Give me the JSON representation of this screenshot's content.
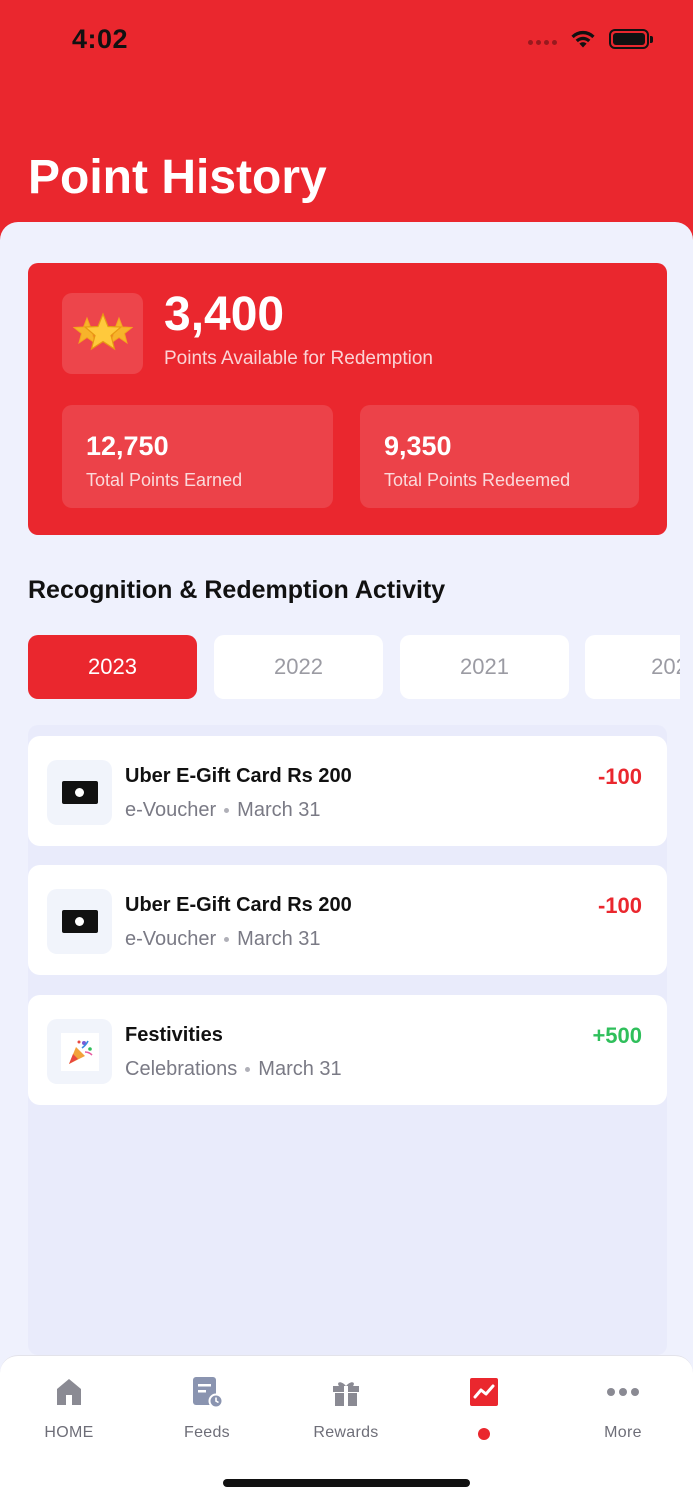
{
  "status_bar": {
    "time": "4:02"
  },
  "header": {
    "title": "Point History"
  },
  "summary": {
    "icon": "star-icon",
    "available_value": "3,400",
    "available_label": "Points Available for Redemption",
    "earned_value": "12,750",
    "earned_label": "Total Points Earned",
    "redeemed_value": "9,350",
    "redeemed_label": "Total Points Redeemed"
  },
  "activity": {
    "section_title": "Recognition & Redemption Activity",
    "years": [
      "2023",
      "2022",
      "2021",
      "202"
    ],
    "selected_year": "2023",
    "items": [
      {
        "title": "Uber E-Gift Card Rs 200",
        "category": "e-Voucher",
        "date": "March 31",
        "points": "-100",
        "icon": "gift-card-icon"
      },
      {
        "title": "Uber E-Gift Card Rs 200",
        "category": "e-Voucher",
        "date": "March 31",
        "points": "-100",
        "icon": "gift-card-icon"
      },
      {
        "title": "Festivities",
        "category": "Celebrations",
        "date": "March 31",
        "points": "+500",
        "icon": "confetti-icon"
      }
    ]
  },
  "tabbar": {
    "items": [
      {
        "label": "HOME",
        "icon": "home-icon"
      },
      {
        "label": "Feeds",
        "icon": "feeds-icon"
      },
      {
        "label": "Rewards",
        "icon": "gift-icon"
      },
      {
        "label": "",
        "icon": "chart-icon"
      },
      {
        "label": "More",
        "icon": "more-icon"
      }
    ],
    "active_index": 3
  },
  "colors": {
    "brand": "#ea272e",
    "positive": "#2fbf5b",
    "background": "#eff1fd"
  }
}
